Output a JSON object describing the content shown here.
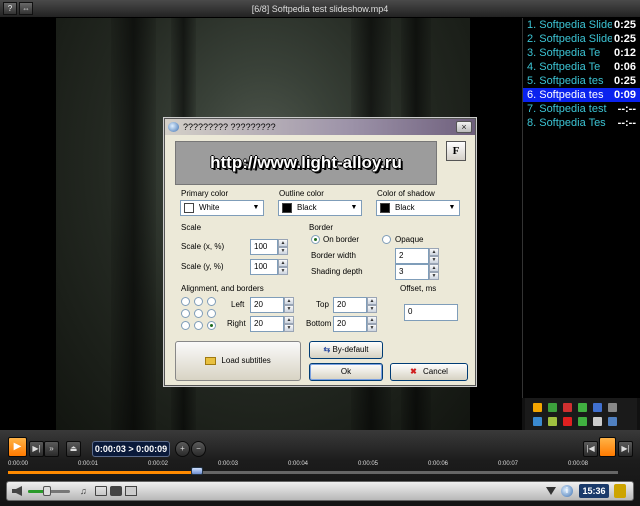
{
  "window": {
    "title": "[6/8] Softpedia test slideshow.mp4",
    "help_label": "?",
    "pin_label": "⇔"
  },
  "playlist": {
    "items": [
      {
        "label": "1. Softpedia Slide",
        "duration": "0:25"
      },
      {
        "label": "2. Softpedia Slide",
        "duration": "0:25"
      },
      {
        "label": "3. Softpedia Te",
        "duration": "0:12"
      },
      {
        "label": "4. Softpedia Te",
        "duration": "0:06"
      },
      {
        "label": "5. Softpedia tes",
        "duration": "0:25"
      },
      {
        "label": "6. Softpedia tes",
        "duration": "0:09"
      },
      {
        "label": "7. Softpedia test",
        "duration": "--:--"
      },
      {
        "label": "8. Softpedia Tes",
        "duration": "--:--"
      }
    ],
    "active_index": 5
  },
  "dialog": {
    "title": "????????? ?????????",
    "close_label": "×",
    "preview_text": "http://www.light-alloy.ru",
    "font_button": "F",
    "primary_color": {
      "label": "Primary color",
      "value": "White",
      "swatch": "#ffffff"
    },
    "outline_color": {
      "label": "Outline color",
      "value": "Black",
      "swatch": "#000000"
    },
    "shadow_color": {
      "label": "Color of shadow",
      "value": "Black",
      "swatch": "#000000"
    },
    "scale": {
      "label": "Scale",
      "x_label": "Scale (x, %)",
      "x_value": "100",
      "y_label": "Scale (y, %)",
      "y_value": "100"
    },
    "border": {
      "label": "Border",
      "on_border": "On border",
      "opaque": "Opaque",
      "width_label": "Border width",
      "width_value": "2",
      "shading_label": "Shading depth",
      "shading_value": "3"
    },
    "alignment": {
      "label": "Alignment, and borders",
      "left_label": "Left",
      "left_value": "20",
      "top_label": "Top",
      "top_value": "20",
      "right_label": "Right",
      "right_value": "20",
      "bottom_label": "Bottom",
      "bottom_value": "20",
      "selected_cell": 8
    },
    "offset": {
      "label": "Offset, ms",
      "value": "0"
    },
    "load_subtitles": "Load subtitles",
    "by_default": "By-default",
    "ok": "Ok",
    "cancel": "Cancel"
  },
  "controls": {
    "time_display": "0:00:03 > 0:00:09",
    "ruler_labels": [
      "0:00:00",
      "0:00:01",
      "0:00:02",
      "0:00:03",
      "0:00:04",
      "0:00:05",
      "0:00:06",
      "0:00:07",
      "0:00:08"
    ],
    "progress": 0.31,
    "clock": "15:36",
    "volume": 0.45
  }
}
